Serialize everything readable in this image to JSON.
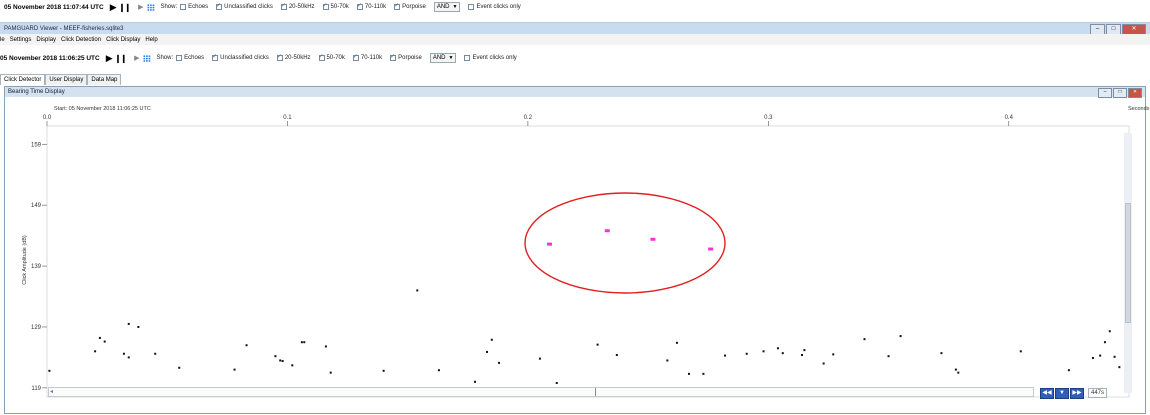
{
  "top_toolbar": {
    "datetime": "05 November 2018 11:07:44 UTC",
    "show_label": "Show:",
    "filters": [
      {
        "label": "Echoes",
        "checked": false
      },
      {
        "label": "Unclassified clicks",
        "checked": true
      },
      {
        "label": "20-50kHz",
        "checked": true
      },
      {
        "label": "50-70k",
        "checked": true
      },
      {
        "label": "70-110k",
        "checked": true
      },
      {
        "label": "Porpoise",
        "checked": true
      }
    ],
    "logic_value": "AND",
    "event_only": {
      "label": "Event clicks only",
      "checked": false
    }
  },
  "window": {
    "title": "PAMGUARD Viewer - MEEF-fisheries.sqlite3"
  },
  "menu": [
    "le",
    "Settings",
    "Display",
    "Click Detection",
    "Click Display",
    "Help"
  ],
  "main_toolbar": {
    "datetime": "05 November 2018 11:06:25 UTC",
    "show_label": "Show:",
    "filters": [
      {
        "label": "Echoes",
        "checked": false
      },
      {
        "label": "Unclassified clicks",
        "checked": true
      },
      {
        "label": "20-50kHz",
        "checked": true
      },
      {
        "label": "50-70k",
        "checked": true
      },
      {
        "label": "70-110k",
        "checked": true
      },
      {
        "label": "Porpoise",
        "checked": true
      }
    ],
    "logic_value": "AND",
    "event_only": {
      "label": "Event clicks only",
      "checked": false
    }
  },
  "tabs": [
    {
      "label": "Click Detector",
      "active": true
    },
    {
      "label": "User Display",
      "active": false
    },
    {
      "label": "Data Map",
      "active": false
    }
  ],
  "panel": {
    "title": "Bearing Time Display",
    "start_label": "Start: 05 November 2018 11:06:25 UTC",
    "seconds_label": "Seconds"
  },
  "nav": {
    "range_label": "447s"
  },
  "colors": {
    "highlight_clicks": "#ff2fd8",
    "annotation_ellipse": "#e02020",
    "clicks": "#111111"
  },
  "chart_data": {
    "type": "scatter",
    "xlabel": "",
    "ylabel": "Click Amplitude (dB)",
    "x_ticks": [
      "0.0",
      "0.1",
      "0.2",
      "0.3",
      "0.4"
    ],
    "y_ticks": [
      "119",
      "129",
      "139",
      "149",
      "159"
    ],
    "xlim": [
      0.0,
      0.45
    ],
    "ylim": [
      117.5,
      162
    ],
    "series": [
      {
        "color": "#111111",
        "points": [
          [
            0.001,
            121.8
          ],
          [
            0.02,
            125.0
          ],
          [
            0.022,
            127.2
          ],
          [
            0.024,
            126.6
          ],
          [
            0.032,
            124.6
          ],
          [
            0.034,
            124.0
          ],
          [
            0.034,
            129.5
          ],
          [
            0.038,
            129.0
          ],
          [
            0.045,
            124.6
          ],
          [
            0.055,
            122.3
          ],
          [
            0.078,
            122.0
          ],
          [
            0.083,
            126.0
          ],
          [
            0.095,
            124.2
          ],
          [
            0.097,
            123.5
          ],
          [
            0.098,
            123.4
          ],
          [
            0.102,
            122.7
          ],
          [
            0.106,
            126.5
          ],
          [
            0.107,
            126.5
          ],
          [
            0.116,
            125.8
          ],
          [
            0.118,
            121.5
          ],
          [
            0.14,
            121.8
          ],
          [
            0.154,
            135.0
          ],
          [
            0.163,
            121.9
          ],
          [
            0.178,
            120.0
          ],
          [
            0.183,
            124.9
          ],
          [
            0.185,
            126.9
          ],
          [
            0.188,
            123.1
          ],
          [
            0.205,
            123.8
          ],
          [
            0.212,
            119.8
          ],
          [
            0.229,
            126.1
          ],
          [
            0.237,
            124.4
          ],
          [
            0.258,
            123.5
          ],
          [
            0.262,
            126.4
          ],
          [
            0.267,
            121.3
          ],
          [
            0.273,
            121.3
          ],
          [
            0.282,
            124.3
          ],
          [
            0.291,
            124.6
          ],
          [
            0.298,
            125.0
          ],
          [
            0.304,
            125.5
          ],
          [
            0.306,
            124.7
          ],
          [
            0.314,
            124.4
          ],
          [
            0.315,
            125.2
          ],
          [
            0.323,
            123.0
          ],
          [
            0.327,
            124.5
          ],
          [
            0.34,
            127.0
          ],
          [
            0.35,
            124.2
          ],
          [
            0.355,
            127.5
          ],
          [
            0.372,
            124.7
          ],
          [
            0.378,
            122.0
          ],
          [
            0.379,
            121.5
          ],
          [
            0.405,
            125.0
          ],
          [
            0.425,
            121.9
          ],
          [
            0.435,
            123.9
          ],
          [
            0.438,
            124.3
          ],
          [
            0.44,
            126.5
          ],
          [
            0.442,
            128.3
          ],
          [
            0.444,
            124.1
          ],
          [
            0.446,
            122.4
          ]
        ]
      },
      {
        "color": "#ff2fd8",
        "points": [
          [
            0.209,
            142.6
          ],
          [
            0.233,
            144.8
          ],
          [
            0.252,
            143.4
          ],
          [
            0.276,
            141.8
          ]
        ]
      }
    ]
  }
}
